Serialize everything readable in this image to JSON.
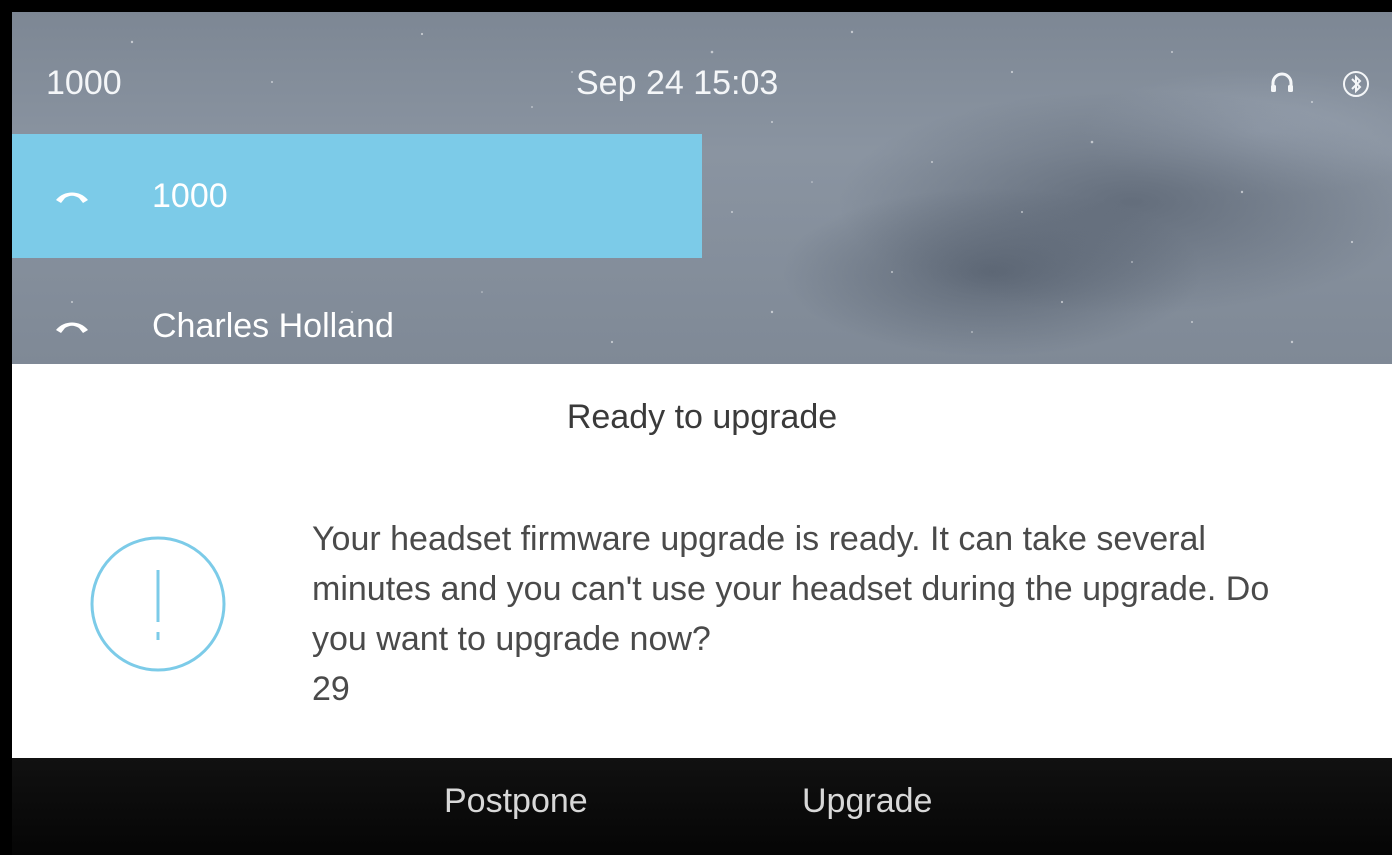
{
  "status_bar": {
    "line_number": "1000",
    "date_time": "Sep 24 15:03",
    "icons": [
      "headset-icon",
      "bluetooth-icon"
    ]
  },
  "lines": [
    {
      "label": "1000",
      "icon": "phone-handset-icon",
      "selected": true
    },
    {
      "label": "Charles Holland",
      "icon": "phone-handset-icon",
      "selected": false
    }
  ],
  "dialog": {
    "title": "Ready to upgrade",
    "icon": "alert-icon",
    "message": "Your headset firmware upgrade is ready. It can take several minutes and you can't use your headset during the upgrade. Do you want to upgrade now?",
    "countdown": "29"
  },
  "softkeys": {
    "postpone_label": "Postpone",
    "upgrade_label": "Upgrade"
  },
  "colors": {
    "selected_line": "#7ccbe8",
    "alert_accent": "#7ccbe8",
    "dialog_background": "#ffffff",
    "softkey_bar": "#0a0a0a"
  }
}
